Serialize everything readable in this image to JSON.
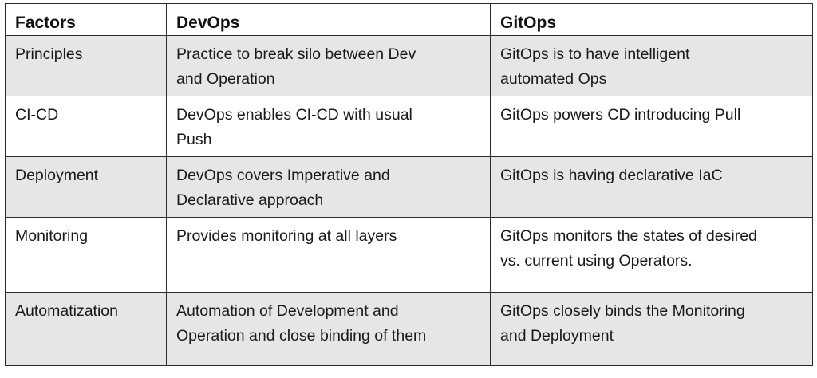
{
  "table": {
    "headers": [
      "Factors",
      "DevOps",
      "GitOps"
    ],
    "rows": [
      {
        "factor": "Principles",
        "devops": [
          "Practice to break silo between Dev",
          "and Operation"
        ],
        "gitops": [
          "GitOps is to have intelligent",
          "automated Ops"
        ]
      },
      {
        "factor": "CI-CD",
        "devops": [
          "DevOps enables CI-CD with usual",
          "Push"
        ],
        "gitops": [
          "GitOps powers CD introducing Pull"
        ]
      },
      {
        "factor": "Deployment",
        "devops": [
          "DevOps covers Imperative and",
          "Declarative approach"
        ],
        "gitops": [
          "GitOps is having declarative IaC"
        ]
      },
      {
        "factor": "Monitoring",
        "devops": [
          "Provides monitoring at all layers"
        ],
        "gitops": [
          "GitOps monitors the states of desired",
          "vs. current using Operators."
        ]
      },
      {
        "factor": "Automatization",
        "devops": [
          "Automation of Development and",
          "Operation and close binding of them"
        ],
        "gitops": [
          "GitOps closely binds the Monitoring",
          "and Deployment"
        ]
      }
    ]
  },
  "colors": {
    "shaded_row": "#e6e6e6",
    "border": "#2b2b2b",
    "text": "#1a1a1a"
  }
}
